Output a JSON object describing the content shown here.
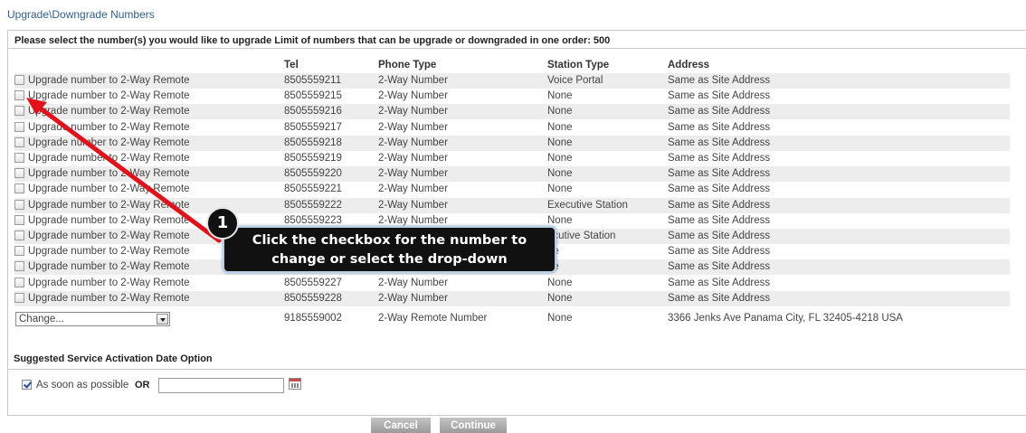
{
  "page": {
    "title": "Upgrade\\Downgrade Numbers"
  },
  "panel": {
    "header": "Please select the number(s) you would like to upgrade Limit of numbers that can be upgrade or downgraded in one order: 500"
  },
  "columns": {
    "tel": "Tel",
    "phone_type": "Phone Type",
    "station_type": "Station Type",
    "address": "Address"
  },
  "rows": [
    {
      "label": "Upgrade number to 2-Way Remote",
      "tel": "8505559211",
      "phone_type": "2-Way Number",
      "station_type": "Voice Portal",
      "address": "Same as Site Address"
    },
    {
      "label": "Upgrade number to 2-Way Remote",
      "tel": "8505559215",
      "phone_type": "2-Way Number",
      "station_type": "None",
      "address": "Same as Site Address"
    },
    {
      "label": "Upgrade number to 2-Way Remote",
      "tel": "8505559216",
      "phone_type": "2-Way Number",
      "station_type": "None",
      "address": "Same as Site Address"
    },
    {
      "label": "Upgrade number to 2-Way Remote",
      "tel": "8505559217",
      "phone_type": "2-Way Number",
      "station_type": "None",
      "address": "Same as Site Address"
    },
    {
      "label": "Upgrade number to 2-Way Remote",
      "tel": "8505559218",
      "phone_type": "2-Way Number",
      "station_type": "None",
      "address": "Same as Site Address"
    },
    {
      "label": "Upgrade number to 2-Way Remote",
      "tel": "8505559219",
      "phone_type": "2-Way Number",
      "station_type": "None",
      "address": "Same as Site Address"
    },
    {
      "label": "Upgrade number to 2-Way Remote",
      "tel": "8505559220",
      "phone_type": "2-Way Number",
      "station_type": "None",
      "address": "Same as Site Address"
    },
    {
      "label": "Upgrade number to 2-Way Remote",
      "tel": "8505559221",
      "phone_type": "2-Way Number",
      "station_type": "None",
      "address": "Same as Site Address"
    },
    {
      "label": "Upgrade number to 2-Way Remote",
      "tel": "8505559222",
      "phone_type": "2-Way Number",
      "station_type": "Executive Station",
      "address": "Same as Site Address"
    },
    {
      "label": "Upgrade number to 2-Way Remote",
      "tel": "8505559223",
      "phone_type": "2-Way Number",
      "station_type": "None",
      "address": "Same as Site Address"
    },
    {
      "label": "Upgrade number to 2-Way Remote",
      "tel": "",
      "phone_type": "",
      "station_type": "ecutive Station",
      "address": "Same as Site Address"
    },
    {
      "label": "Upgrade number to 2-Way Remote",
      "tel": "",
      "phone_type": "",
      "station_type": "ne",
      "address": "Same as Site Address"
    },
    {
      "label": "Upgrade number to 2-Way Remote",
      "tel": "",
      "phone_type": "",
      "station_type": "ne",
      "address": "Same as Site Address"
    },
    {
      "label": "Upgrade number to 2-Way Remote",
      "tel": "8505559227",
      "phone_type": "2-Way Number",
      "station_type": "None",
      "address": "Same as Site Address"
    },
    {
      "label": "Upgrade number to 2-Way Remote",
      "tel": "8505559228",
      "phone_type": "2-Way Number",
      "station_type": "None",
      "address": "Same as Site Address"
    }
  ],
  "change_row": {
    "select_value": "Change...",
    "tel": "9185559002",
    "phone_type": "2-Way Remote Number",
    "station_type": "None",
    "address": "3366 Jenks Ave Panama City, FL 32405-4218 USA"
  },
  "activation": {
    "title": "Suggested Service Activation Date Option",
    "asap_label": "As soon as possible",
    "or_label": "OR",
    "date_value": ""
  },
  "buttons": {
    "cancel": "Cancel",
    "continue": "Continue"
  },
  "callout": {
    "number": "1",
    "line1": "Click the checkbox for the number to",
    "line2": "change or select the drop-down"
  },
  "colors": {
    "title_blue": "#2f5f8f",
    "arrow_red": "#e3121a",
    "callout_bg": "#111111",
    "row_shade": "#ededed"
  }
}
